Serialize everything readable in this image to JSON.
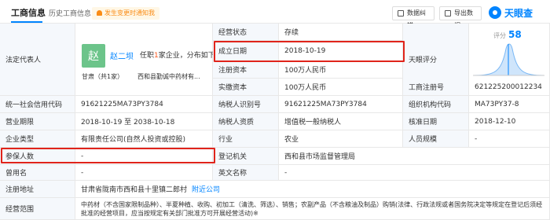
{
  "header": {
    "tab_active": "工商信息",
    "tab_history": "历史工商信息",
    "history_count": "›",
    "notice": "发生变更时通知我",
    "btn_correct": "数据纠错",
    "btn_export": "导出数据",
    "logo": "天眼查"
  },
  "legal": {
    "label": "法定代表人",
    "avatar_char": "赵",
    "name": "赵二坝",
    "roles_prefix": "任职",
    "roles_count": "1",
    "roles_suffix": "家企业，分布如下",
    "province": "甘肃（共1家）",
    "company": "西和县勤诚中药材有..."
  },
  "rows": {
    "status_label": "经营状态",
    "status_value": "存续",
    "found_label": "成立日期",
    "found_value": "2018-10-19",
    "score_label_cell": "天眼评分",
    "reg_cap_label": "注册资本",
    "reg_cap_value": "100万人民币",
    "paid_cap_label": "实缴资本",
    "paid_cap_value": "100万人民币",
    "biz_reg_label": "工商注册号",
    "biz_reg_value": "621225200012234",
    "uscc_label": "统一社会信用代码",
    "uscc_value": "91621225MA73PY3784",
    "taxid_label": "纳税人识别号",
    "taxid_value": "91621225MA73PY3784",
    "org_code_label": "组织机构代码",
    "org_code_value": "MA73PY37-8",
    "term_label": "营业期限",
    "term_value": "2018-10-19 至 2038-10-18",
    "taxpayer_label": "纳税人资质",
    "taxpayer_value": "增值税一般纳税人",
    "approve_label": "核准日期",
    "approve_value": "2018-12-10",
    "type_label": "企业类型",
    "type_value": "有限责任公司(自然人投资或控股)",
    "industry_label": "行业",
    "industry_value": "农业",
    "staff_label": "人员规模",
    "staff_value": "-",
    "insured_label": "参保人数",
    "insured_value": "-",
    "authority_label": "登记机关",
    "authority_value": "西和县市场监督管理局",
    "former_label": "曾用名",
    "former_value": "-",
    "en_label": "英文名称",
    "en_value": "-",
    "addr_label": "注册地址",
    "addr_value": "甘肃省陇南市西和县十里镇二郎村",
    "addr_link": "附近公司",
    "scope_label": "经营范围",
    "scope_value_1": "中药材（不含国家限制品种）、半夏种植、收购、初加工（清洗、筛选）、销售；农副产品（不含粮油及制品）购销(法律、行政法规或者国务院决定等规定在登记后须经",
    "scope_value_2": "批准的经营项目，应当按规定有关部门批准方可开展经营活动)※"
  },
  "score": {
    "label": "评分",
    "value": "58"
  },
  "colors": {
    "accent": "#0084ff",
    "highlight": "#e0241b",
    "label_bg": "#f5f8fc"
  }
}
